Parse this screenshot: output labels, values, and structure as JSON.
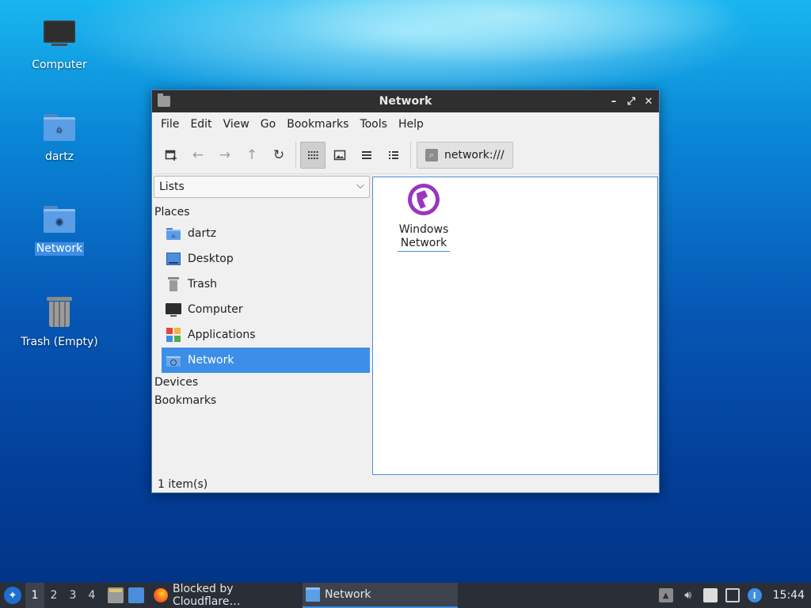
{
  "desktop": {
    "icons": [
      {
        "label": "Computer",
        "icon": "computer-icon"
      },
      {
        "label": "dartz",
        "icon": "home-folder-icon"
      },
      {
        "label": "Network",
        "icon": "network-folder-icon",
        "selected": true
      },
      {
        "label": "Trash (Empty)",
        "icon": "trash-icon"
      }
    ]
  },
  "window": {
    "title": "Network",
    "controls": {
      "minimize": "–",
      "maximize": "⤢",
      "close": "✕"
    },
    "menu": [
      "File",
      "Edit",
      "View",
      "Go",
      "Bookmarks",
      "Tools",
      "Help"
    ],
    "toolbar": {
      "buttons": [
        {
          "icon": "new-window-icon"
        },
        {
          "icon": "back-arrow-icon",
          "disabled": true
        },
        {
          "icon": "forward-arrow-icon",
          "disabled": true
        },
        {
          "icon": "up-arrow-icon",
          "disabled": true
        },
        {
          "icon": "reload-icon"
        },
        {
          "icon": "icon-view-icon",
          "active": true
        },
        {
          "icon": "thumbnail-view-icon"
        },
        {
          "icon": "compact-view-icon"
        },
        {
          "icon": "detailed-list-view-icon"
        }
      ],
      "location": "network:///"
    },
    "sidepane": {
      "mode": "Lists",
      "sections": {
        "places": "Places",
        "devices": "Devices",
        "bookmarks": "Bookmarks"
      },
      "places": [
        {
          "label": "dartz",
          "icon": "home-folder-icon"
        },
        {
          "label": "Desktop",
          "icon": "desktop-icon"
        },
        {
          "label": "Trash",
          "icon": "trash-icon"
        },
        {
          "label": "Computer",
          "icon": "computer-icon"
        },
        {
          "label": "Applications",
          "icon": "applications-icon"
        },
        {
          "label": "Network",
          "icon": "network-icon",
          "selected": true
        }
      ]
    },
    "files": [
      {
        "line1": "Windows",
        "line2": "Network",
        "icon": "windows-network-globe-icon"
      }
    ],
    "status": "1 item(s)"
  },
  "taskbar": {
    "workspaces": [
      "1",
      "2",
      "3",
      "4"
    ],
    "active_workspace": "1",
    "tasks": [
      {
        "label": "Blocked by Cloudflare…",
        "icon": "firefox-icon"
      },
      {
        "label": "Network",
        "icon": "folder-icon",
        "active": true
      }
    ],
    "tray_icons": [
      "updates-icon",
      "volume-icon",
      "clipboard-icon",
      "network-tray-icon",
      "info-icon"
    ],
    "clock": "15:44"
  },
  "colors": {
    "accent": "#3d8ee6",
    "titlebar": "#2f2f2f",
    "taskbar": "#2a2e36",
    "network_globe": "#9a35c1"
  }
}
